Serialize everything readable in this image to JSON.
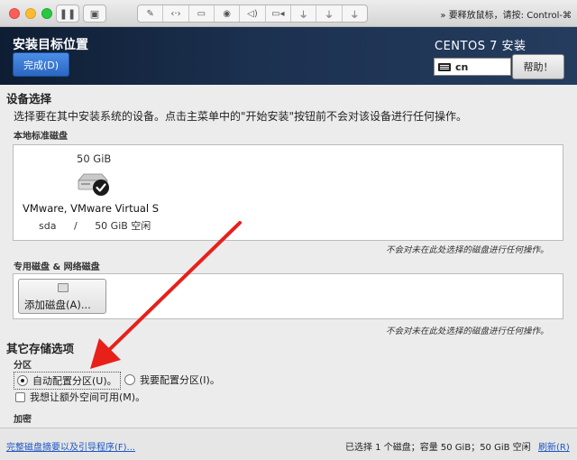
{
  "vm_toolbar": {
    "hint": "要释放鼠标，请按: Control-⌘",
    "icons": [
      "pause-icon",
      "snapshot-icon",
      "wrench-icon",
      "network-icon",
      "harddisk-icon",
      "cdrom-icon",
      "sound-icon",
      "camera-icon",
      "usb-icon-1",
      "usb-icon-2",
      "usb-icon-3",
      "chevron-right-icon"
    ]
  },
  "header": {
    "title": "安装目标位置",
    "done_label": "完成(D)",
    "product": "CENTOS 7 安装",
    "keyboard_layout": "cn",
    "help_label": "帮助！"
  },
  "device_selection": {
    "title": "设备选择",
    "description": "选择要在其中安装系统的设备。点击主菜单中的\"开始安装\"按钮前不会对该设备进行任何操作。",
    "local_disks_title": "本地标准磁盘",
    "disk": {
      "size": "50 GiB",
      "name": "VMware, VMware Virtual S",
      "device": "sda",
      "separator": "/",
      "free": "50 GiB 空闲",
      "selected": true
    },
    "local_note": "不会对未在此处选择的磁盘进行任何操作。",
    "special_disks_title": "专用磁盘 & 网络磁盘",
    "add_disk_label": "添加磁盘(A)...",
    "special_note": "不会对未在此处选择的磁盘进行任何操作。"
  },
  "other_storage": {
    "title": "其它存储选项",
    "partitioning_title": "分区",
    "auto_label": "自动配置分区(U)。",
    "manual_label": "我要配置分区(I)。",
    "auto_selected": true,
    "extra_space_label": "我想让额外空间可用(M)。",
    "extra_space_checked": false,
    "encryption_title": "加密"
  },
  "footer": {
    "summary_link": "完整磁盘摘要以及引导程序(F)...",
    "status": "已选择 1 个磁盘；容量 50 GiB；50 GiB 空闲",
    "refresh_label": "刷新(R)"
  },
  "colors": {
    "header_dark": "#0e1d33",
    "done_button": "#2a67c2",
    "link": "#1f56c4",
    "annotation_arrow": "#e8201a"
  }
}
